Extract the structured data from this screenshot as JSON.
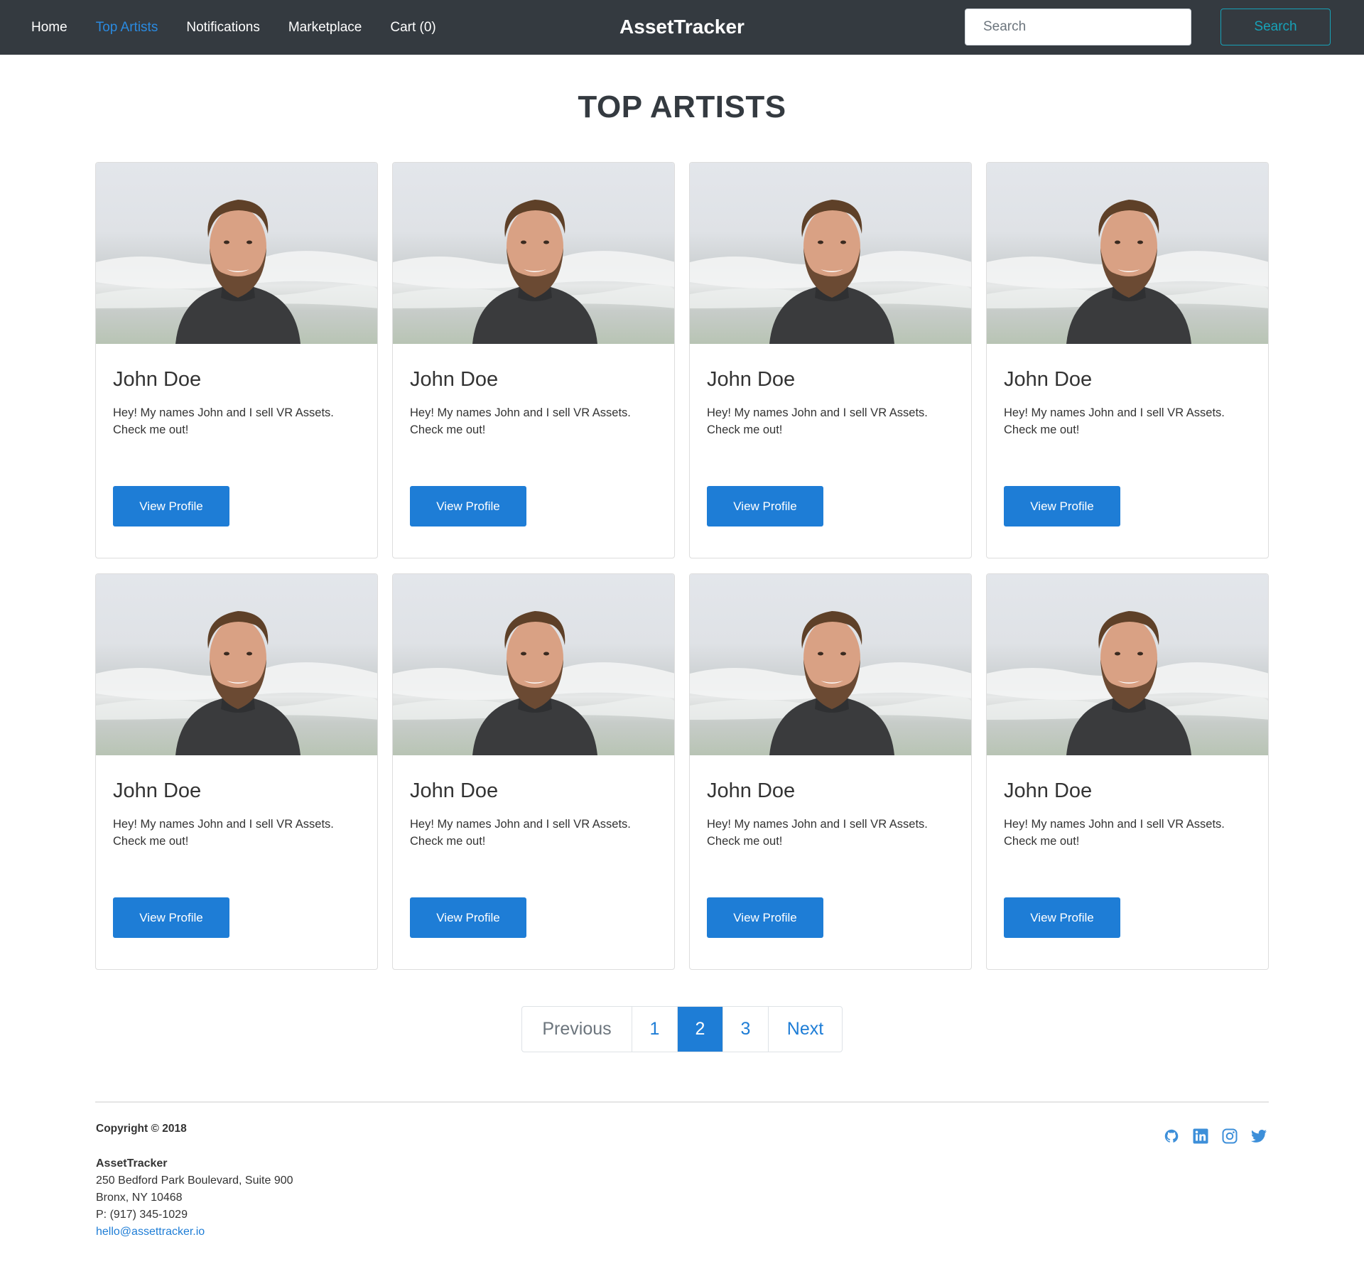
{
  "navbar": {
    "links": [
      {
        "label": "Home",
        "active": false
      },
      {
        "label": "Top Artists",
        "active": true
      },
      {
        "label": "Notifications",
        "active": false
      },
      {
        "label": "Marketplace",
        "active": false
      },
      {
        "label": "Cart (0)",
        "active": false
      }
    ],
    "brand": "AssetTracker",
    "search_placeholder": "Search",
    "search_button": "Search"
  },
  "page": {
    "title": "TOP ARTISTS"
  },
  "artists": [
    {
      "name": "John Doe",
      "bio": "Hey! My names John and I sell VR Assets. Check me out!",
      "button": "View Profile"
    },
    {
      "name": "John Doe",
      "bio": "Hey! My names John and I sell VR Assets. Check me out!",
      "button": "View Profile"
    },
    {
      "name": "John Doe",
      "bio": "Hey! My names John and I sell VR Assets. Check me out!",
      "button": "View Profile"
    },
    {
      "name": "John Doe",
      "bio": "Hey! My names John and I sell VR Assets. Check me out!",
      "button": "View Profile"
    },
    {
      "name": "John Doe",
      "bio": "Hey! My names John and I sell VR Assets. Check me out!",
      "button": "View Profile"
    },
    {
      "name": "John Doe",
      "bio": "Hey! My names John and I sell VR Assets. Check me out!",
      "button": "View Profile"
    },
    {
      "name": "John Doe",
      "bio": "Hey! My names John and I sell VR Assets. Check me out!",
      "button": "View Profile"
    },
    {
      "name": "John Doe",
      "bio": "Hey! My names John and I sell VR Assets. Check me out!",
      "button": "View Profile"
    }
  ],
  "pagination": {
    "previous": "Previous",
    "pages": [
      "1",
      "2",
      "3"
    ],
    "current": "2",
    "next": "Next"
  },
  "footer": {
    "copyright": "Copyright © 2018",
    "company": "AssetTracker",
    "address_line1": "250 Bedford Park Boulevard, Suite 900",
    "address_line2": "Bronx, NY 10468",
    "phone": "P: (917) 345-1029",
    "email": "hello@assettracker.io",
    "social_icons": [
      "github-icon",
      "linkedin-icon",
      "instagram-icon",
      "twitter-icon"
    ]
  },
  "colors": {
    "navbar_bg": "#343a40",
    "accent": "#1e7dd6",
    "search_button": "#17a2b8"
  }
}
